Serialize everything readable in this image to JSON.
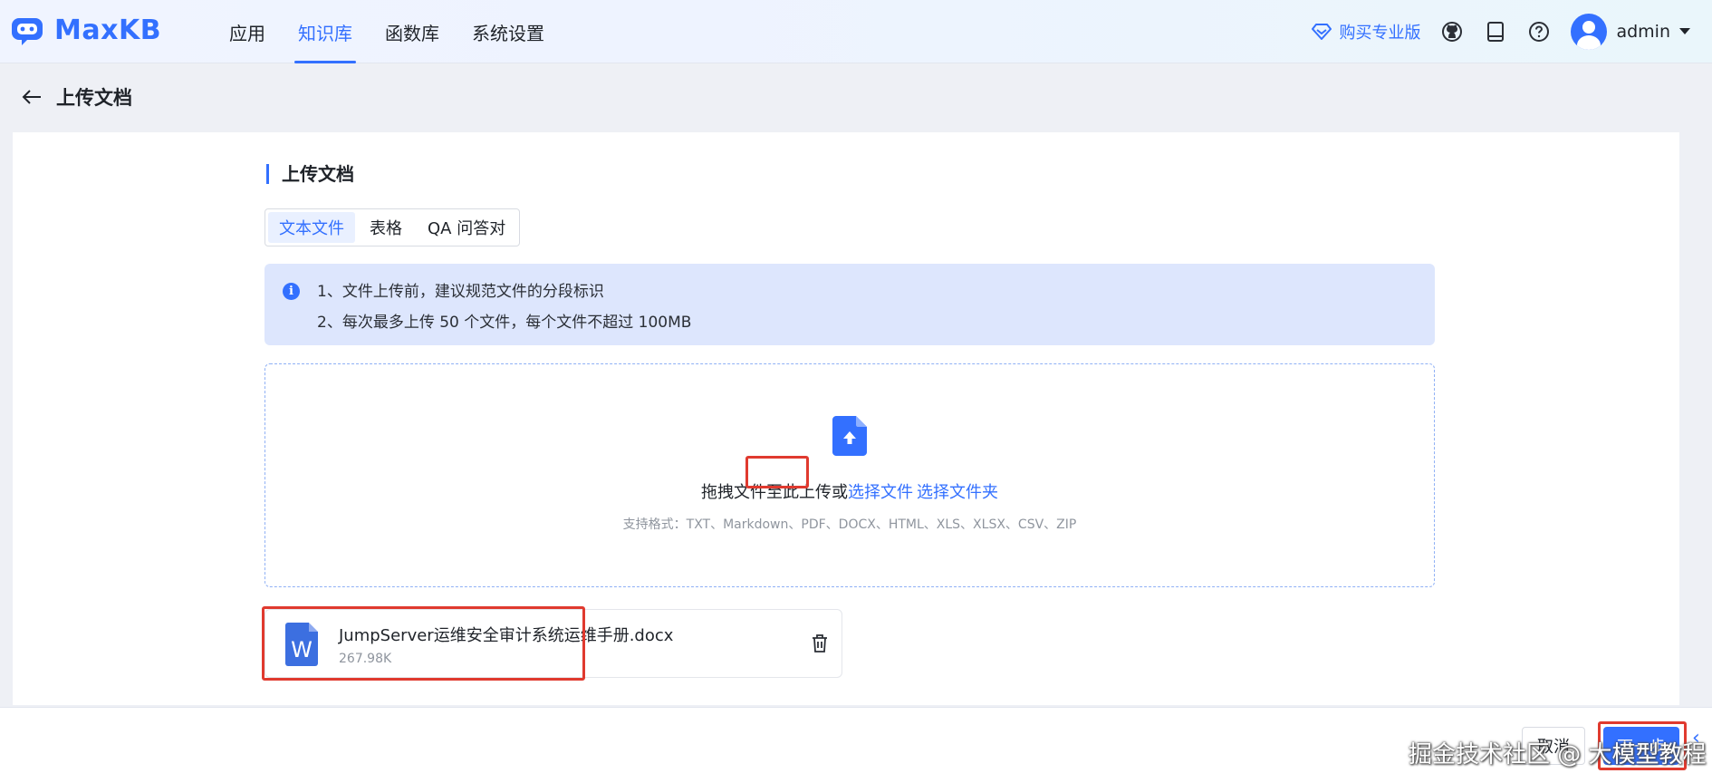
{
  "app": {
    "logo_text": "MaxKB"
  },
  "nav": {
    "items": [
      {
        "label": "应用",
        "active": false
      },
      {
        "label": "知识库",
        "active": true
      },
      {
        "label": "函数库",
        "active": false
      },
      {
        "label": "系统设置",
        "active": false
      }
    ]
  },
  "header": {
    "buy_pro": "购买专业版",
    "username": "admin",
    "icons": [
      "github-icon",
      "docs-icon",
      "help-icon"
    ]
  },
  "page": {
    "back_title": "上传文档"
  },
  "upload": {
    "section_title": "上传文档",
    "tabs": [
      {
        "label": "文本文件",
        "active": true
      },
      {
        "label": "表格",
        "active": false
      },
      {
        "label": "QA 问答对",
        "active": false
      }
    ],
    "tips": [
      "1、文件上传前，建议规范文件的分段标识",
      "2、每次最多上传 50 个文件，每个文件不超过 100MB"
    ],
    "drop_text": "拖拽文件至此上传或",
    "select_file": "选择文件",
    "select_folder": "选择文件夹",
    "formats": "支持格式：TXT、Markdown、PDF、DOCX、HTML、XLS、XLSX、CSV、ZIP"
  },
  "files": [
    {
      "icon_letter": "W",
      "name": "JumpServer运维安全审计系统运维手册.docx",
      "size": "267.98K"
    }
  ],
  "footer": {
    "cancel_label": "取消",
    "next_label": "下一步"
  },
  "watermark": "掘金技术社区 @ 大模型教程",
  "colors": {
    "accent": "#3370ff",
    "highlight": "#e03a2f",
    "info_bg": "#dde6fd"
  }
}
